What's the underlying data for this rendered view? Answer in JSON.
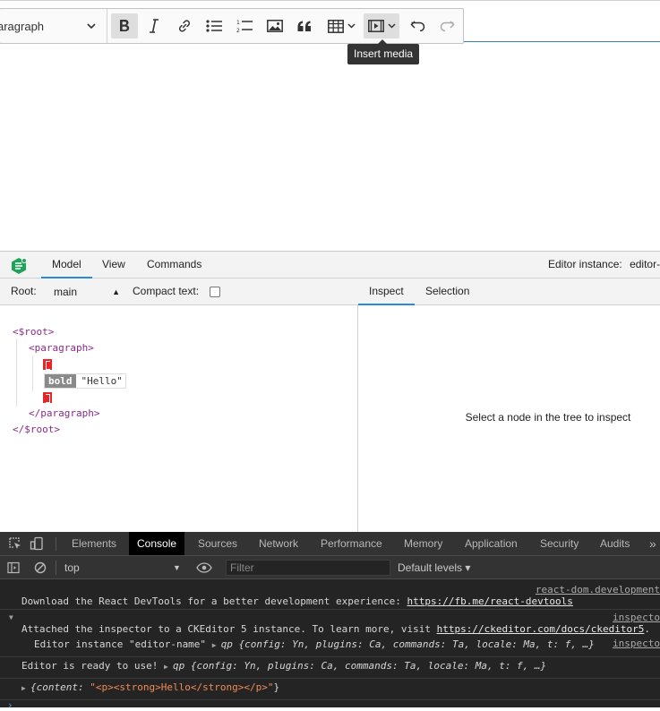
{
  "editor": {
    "heading_value": "aragraph",
    "tooltip": "Insert media"
  },
  "inspector": {
    "tabs": [
      "Model",
      "View",
      "Commands"
    ],
    "active_tab": "Model",
    "instance_label": "Editor instance:",
    "instance_value": "editor-",
    "root_label": "Root:",
    "root_value": "main",
    "compact_label": "Compact text:",
    "right_tabs": [
      "Inspect",
      "Selection"
    ],
    "placeholder": "Select a node in the tree to inspect",
    "tree": {
      "root_open": "<$root>",
      "para_open": "<paragraph>",
      "attr": "bold",
      "text": "\"Hello\"",
      "para_close": "</paragraph>",
      "root_close": "</$root>"
    }
  },
  "devtools": {
    "tabs": [
      "Elements",
      "Console",
      "Sources",
      "Network",
      "Performance",
      "Memory",
      "Application",
      "Security",
      "Audits"
    ],
    "more": "»",
    "active_tab": "Console",
    "context": "top",
    "filter_placeholder": "Filter",
    "levels": "Default levels ▾",
    "messages": [
      {
        "src": "react-dom.development",
        "text": "Download the React DevTools for a better development experience: ",
        "link": "https://fb.me/react-devtools"
      },
      {
        "src": "inspecto",
        "text": "Attached the inspector to a CKEditor 5 instance. To learn more, visit ",
        "link": "https://ckeditor.com/docs/ckeditor5",
        "tail": "."
      },
      {
        "src": "inspecto",
        "prefix": "Editor instance \"editor-name\" ",
        "obj": "qp {config: Yn, plugins: Ca, commands: Ta, locale: Ma, t: f, …}"
      },
      {
        "prefix": "Editor is ready to use! ",
        "obj": "qp {config: Yn, plugins: Ca, commands: Ta, locale: Ma, t: f, …}"
      },
      {
        "obj_key": "{content: ",
        "obj_str": "\"<p><strong>Hello</strong></p>\"",
        "obj_end": "}"
      }
    ]
  },
  "colors": {
    "accent": "#2a8ad2",
    "selection_marker": "#e8262a",
    "tag": "#8a2a8a",
    "string": "#f28b54"
  }
}
